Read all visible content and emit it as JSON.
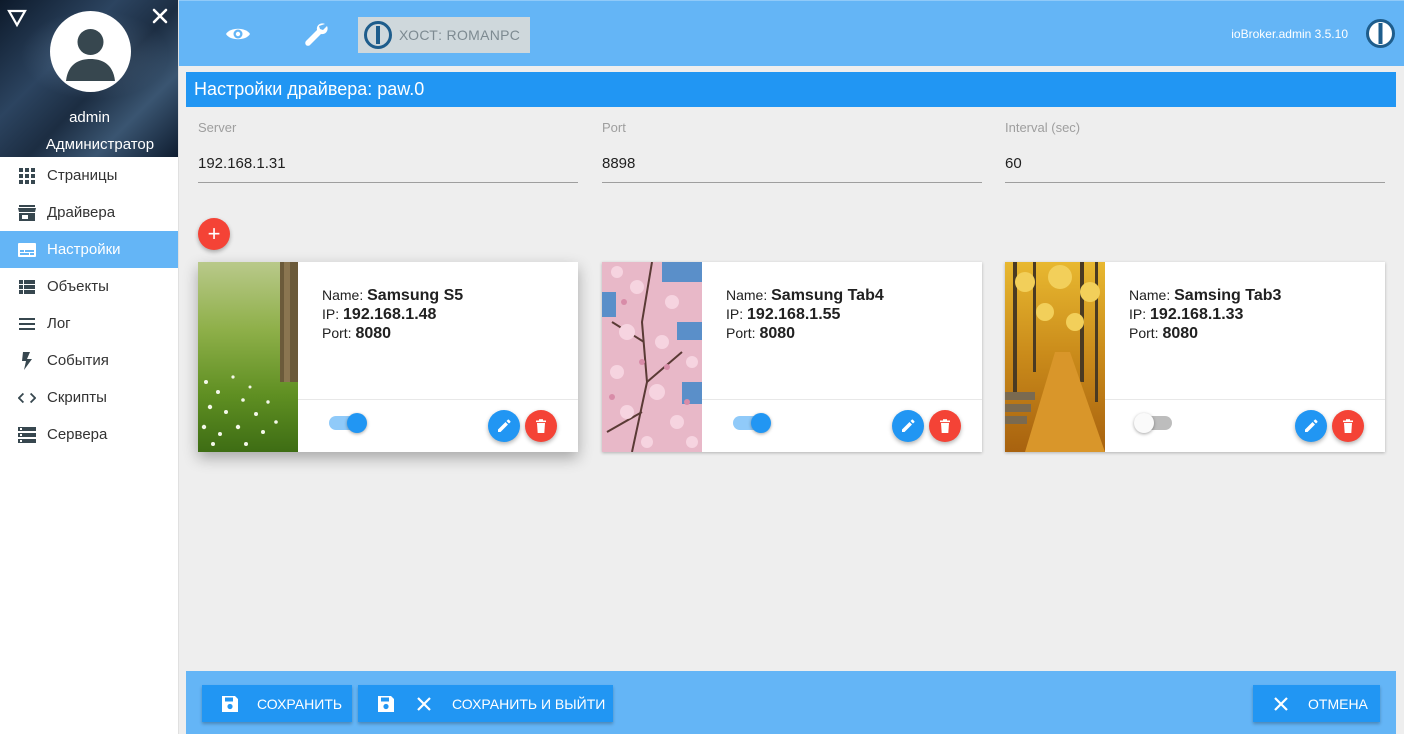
{
  "sidebar": {
    "user_name": "admin",
    "user_role": "Администратор",
    "items": [
      {
        "label": "Страницы",
        "icon": "grid-icon"
      },
      {
        "label": "Драйвера",
        "icon": "store-icon"
      },
      {
        "label": "Настройки",
        "icon": "settings-panel-icon",
        "active": true
      },
      {
        "label": "Объекты",
        "icon": "list-icon"
      },
      {
        "label": "Лог",
        "icon": "menu-lines-icon"
      },
      {
        "label": "События",
        "icon": "flash-icon"
      },
      {
        "label": "Скрипты",
        "icon": "code-icon"
      },
      {
        "label": "Сервера",
        "icon": "server-icon"
      }
    ]
  },
  "topbar": {
    "host_label": "ХОСТ: ROMANPC",
    "version": "ioBroker.admin 3.5.10"
  },
  "page": {
    "title": "Настройки драйвера: paw.0"
  },
  "form": {
    "server": {
      "label": "Server",
      "value": "192.168.1.31"
    },
    "port": {
      "label": "Port",
      "value": "8898"
    },
    "interval": {
      "label": "Interval (sec)",
      "value": "60"
    }
  },
  "add_button": "+",
  "labels": {
    "name": "Name:",
    "ip": "IP:",
    "port": "Port:"
  },
  "devices": [
    {
      "name": "Samsung S5",
      "ip": "192.168.1.48",
      "port": "8080",
      "enabled": true
    },
    {
      "name": "Samsung Tab4",
      "ip": "192.168.1.55",
      "port": "8080",
      "enabled": true
    },
    {
      "name": "Samsing Tab3",
      "ip": "192.168.1.33",
      "port": "8080",
      "enabled": false
    }
  ],
  "bottom": {
    "save": "СОХРАНИТЬ",
    "save_exit": "СОХРАНИТЬ И ВЫЙТИ",
    "cancel": "ОТМЕНА"
  },
  "colors": {
    "accent": "#2196f3",
    "bar": "#64b5f6",
    "danger": "#f44336"
  }
}
